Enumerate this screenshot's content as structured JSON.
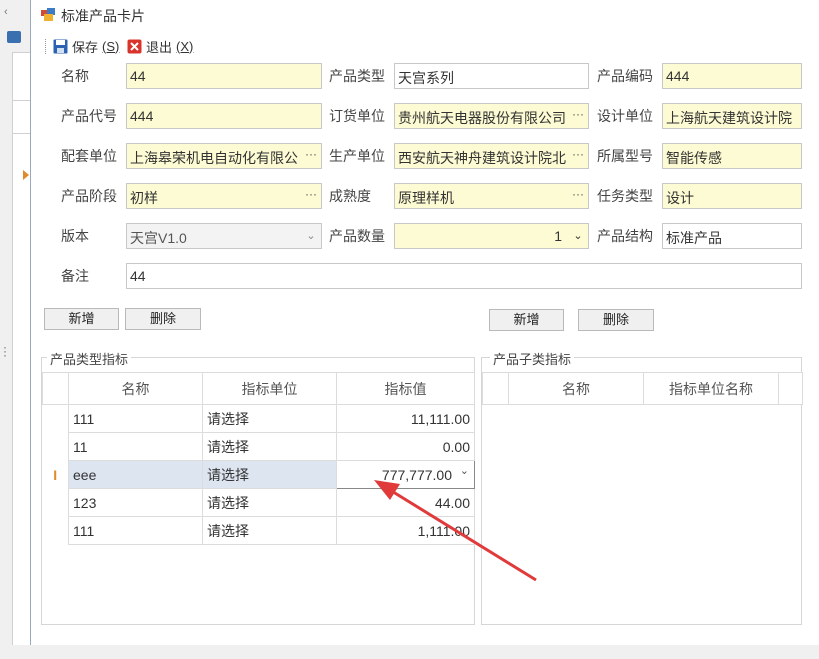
{
  "window": {
    "title": "标准产品卡片"
  },
  "toolbar": {
    "save_label": "保存",
    "save_key": "(S)",
    "exit_label": "退出",
    "exit_key": "(X)"
  },
  "form": {
    "name_label": "名称",
    "name_value": "44",
    "type_label": "产品类型",
    "type_value": "天宫系列",
    "code_label": "产品编码",
    "code_value": "444",
    "alias_label": "产品代号",
    "alias_value": "444",
    "order_unit_label": "订货单位",
    "order_unit_value": "贵州航天电器股份有限公司",
    "design_unit_label": "设计单位",
    "design_unit_value": "上海航天建筑设计院",
    "assembly_unit_label": "配套单位",
    "assembly_unit_value": "上海皋荣机电自动化有限公",
    "production_unit_label": "生产单位",
    "production_unit_value": "西安航天神舟建筑设计院北",
    "model_label": "所属型号",
    "model_value": "智能传感",
    "stage_label": "产品阶段",
    "stage_value": "初样",
    "maturity_label": "成熟度",
    "maturity_value": "原理样机",
    "task_type_label": "任务类型",
    "task_type_value": "设计",
    "version_label": "版本",
    "version_value": "天宫V1.0",
    "quantity_label": "产品数量",
    "quantity_value": "1",
    "structure_label": "产品结构",
    "structure_value": "标准产品",
    "remark_label": "备注",
    "remark_value": "44"
  },
  "buttons": {
    "add_left": "新增",
    "delete_left": "删除",
    "add_right": "新增",
    "delete_right": "删除"
  },
  "left_group": {
    "title": "产品类型指标",
    "headers": [
      "名称",
      "指标单位",
      "指标值"
    ],
    "rows": [
      {
        "name": "111",
        "unit": "请选择",
        "value": "11,111.00"
      },
      {
        "name": "11",
        "unit": "请选择",
        "value": "0.00"
      },
      {
        "name": "eee",
        "unit": "请选择",
        "value": "777,777.00"
      },
      {
        "name": "123",
        "unit": "请选择",
        "value": "44.00"
      },
      {
        "name": "111",
        "unit": "请选择",
        "value": "1,111.00"
      }
    ],
    "row_indicator": "I"
  },
  "right_group": {
    "title": "产品子类指标",
    "headers": [
      "名称",
      "指标单位名称"
    ]
  },
  "colors": {
    "required_bg": "#fdfbd3",
    "selected_row": "#dde5f1",
    "arrow": "#e03a3a"
  }
}
